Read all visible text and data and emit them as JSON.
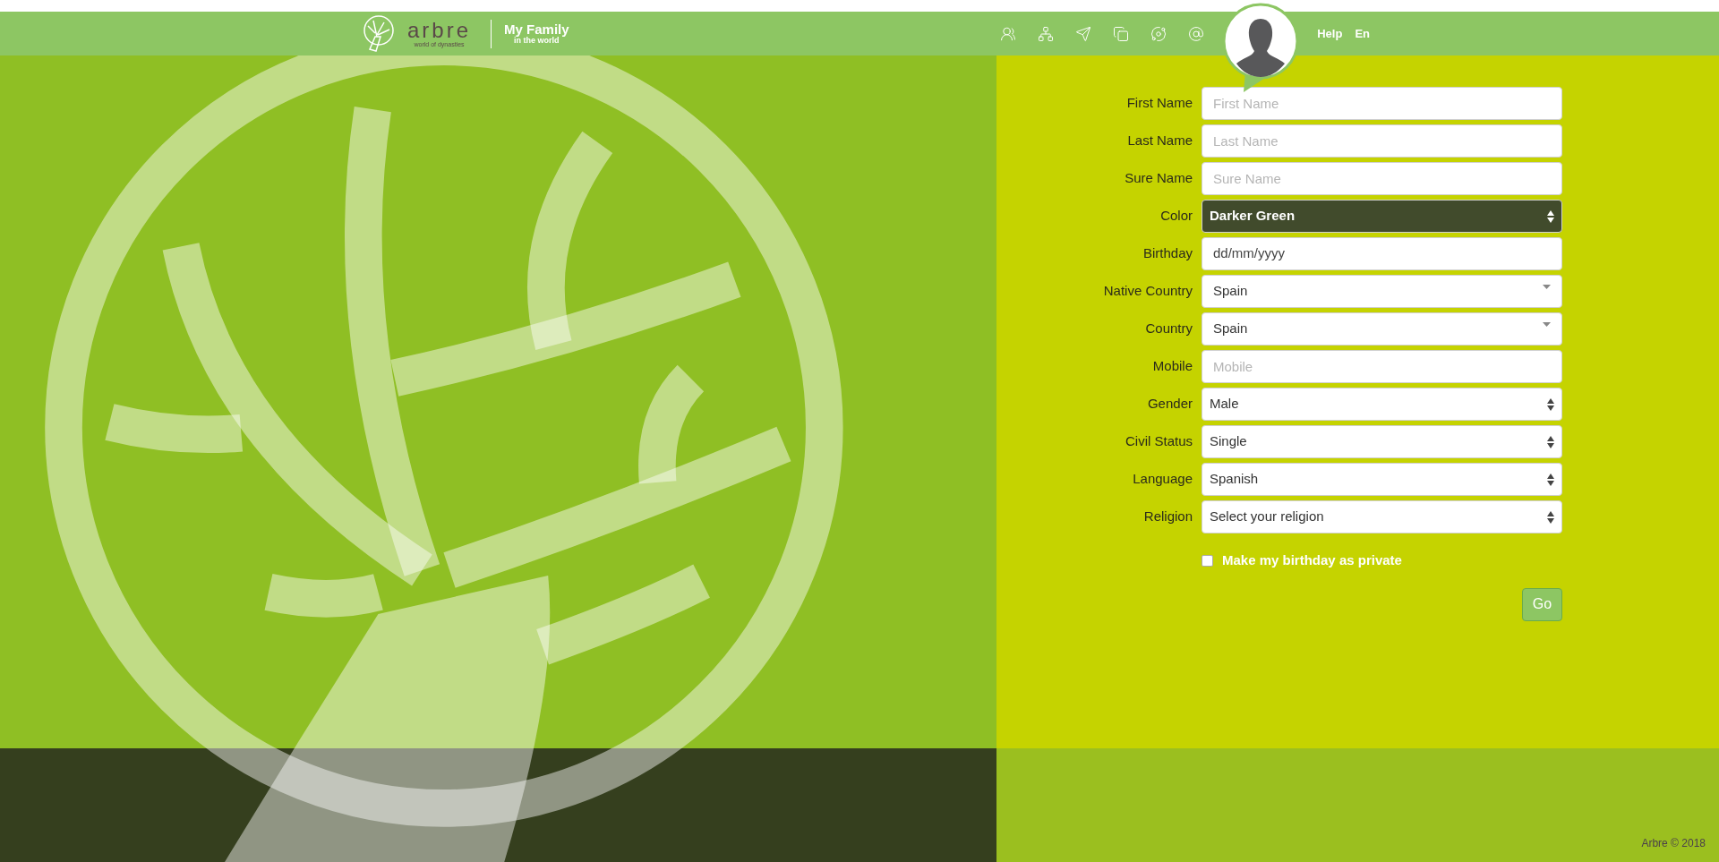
{
  "header": {
    "logo_name": "arbre",
    "logo_tagline": "world of dynasties",
    "app_title": "My Family",
    "app_subtitle": "in the world",
    "links": [
      "Help",
      "En"
    ]
  },
  "form": {
    "fields": [
      {
        "label": "First Name",
        "kind": "text",
        "placeholder": "First Name"
      },
      {
        "label": "Last Name",
        "kind": "text",
        "placeholder": "Last Name"
      },
      {
        "label": "Sure Name",
        "kind": "text",
        "placeholder": "Sure Name"
      },
      {
        "label": "Color",
        "kind": "select",
        "value": "Darker Green",
        "color": "#414b2c"
      },
      {
        "label": "Birthday",
        "kind": "date",
        "value": "dd/mm/yyyy"
      },
      {
        "label": "Native Country",
        "kind": "dropdown",
        "value": "Spain"
      },
      {
        "label": "Country",
        "kind": "dropdown",
        "value": "Spain"
      },
      {
        "label": "Mobile",
        "kind": "text",
        "placeholder": "Mobile"
      },
      {
        "label": "Gender",
        "kind": "select",
        "value": "Male"
      },
      {
        "label": "Civil Status",
        "kind": "select",
        "value": "Single"
      },
      {
        "label": "Language",
        "kind": "select",
        "value": "Spanish"
      },
      {
        "label": "Religion",
        "kind": "select",
        "value": "Select your religion"
      }
    ],
    "private_checkbox": {
      "label": "Make my birthday as private",
      "checked": false
    },
    "submit": "Go"
  },
  "footer": {
    "copyright": "Arbre © 2018"
  }
}
